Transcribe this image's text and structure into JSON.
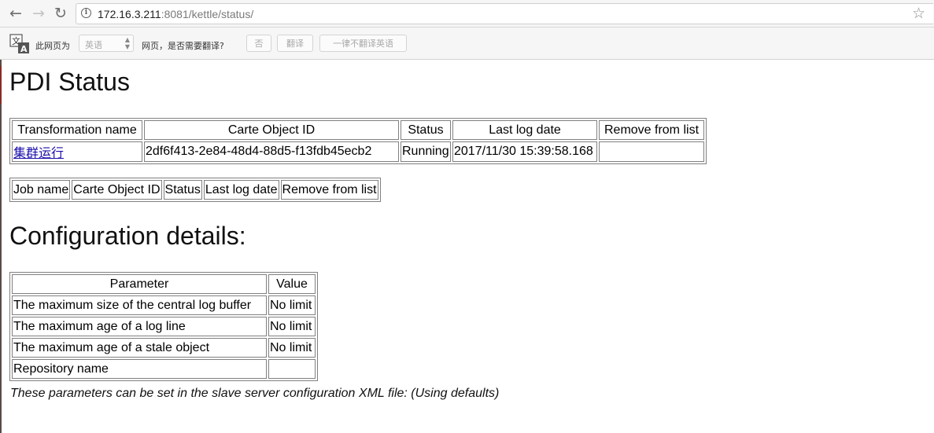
{
  "browser": {
    "url_host": "172.16.3.211",
    "url_rest": ":8081/kettle/status/"
  },
  "translate_bar": {
    "prefix_label": "此网页为",
    "language_value": "英语",
    "question_label": "网页，是否需要翻译?",
    "no_button": "否",
    "translate_button": "翻译",
    "never_button": "一律不翻译英语"
  },
  "page": {
    "title": "PDI Status",
    "transformations": {
      "headers": [
        "Transformation name",
        "Carte Object ID",
        "Status",
        "Last log date",
        "Remove from list"
      ],
      "rows": [
        {
          "name": "集群运行",
          "id": "2df6f413-2e84-48d4-88d5-f13fdb45ecb2",
          "status": "Running",
          "last_log_date": "2017/11/30 15:39:58.168",
          "remove": ""
        }
      ]
    },
    "jobs": {
      "headers": [
        "Job name",
        "Carte Object ID",
        "Status",
        "Last log date",
        "Remove from list"
      ]
    },
    "config_title": "Configuration details:",
    "config": {
      "headers": [
        "Parameter",
        "Value"
      ],
      "rows": [
        {
          "parameter": "The maximum size of the central log buffer",
          "value": "No limit"
        },
        {
          "parameter": "The maximum age of a log line",
          "value": "No limit"
        },
        {
          "parameter": "The maximum age of a stale object",
          "value": "No limit"
        },
        {
          "parameter": "Repository name",
          "value": ""
        }
      ]
    },
    "note": "These parameters can be set in the slave server configuration XML file: (Using defaults)"
  }
}
